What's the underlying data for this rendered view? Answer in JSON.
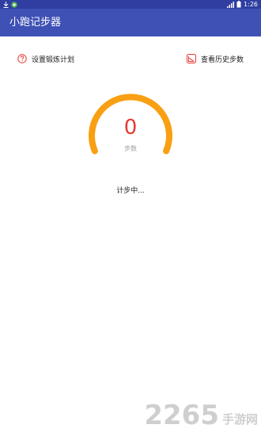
{
  "status_bar": {
    "time": "1:26",
    "icons": [
      "download-icon",
      "app-notification-icon",
      "signal-icon",
      "battery-icon"
    ]
  },
  "app_bar": {
    "title": "小跑记步器"
  },
  "actions": {
    "set_plan": {
      "label": "设置锻炼计划",
      "icon": "question-icon"
    },
    "history": {
      "label": "查看历史步数",
      "icon": "history-chart-icon"
    }
  },
  "counter": {
    "steps": "0",
    "unit": "步数"
  },
  "status_text": "计步中...",
  "watermark": {
    "number": "2265",
    "site": "手游网"
  },
  "colors": {
    "status_bar": "#2f3ea0",
    "app_bar": "#3f51b5",
    "gauge": "#f8a012",
    "count": "#e53935",
    "icon": "#e53935"
  }
}
